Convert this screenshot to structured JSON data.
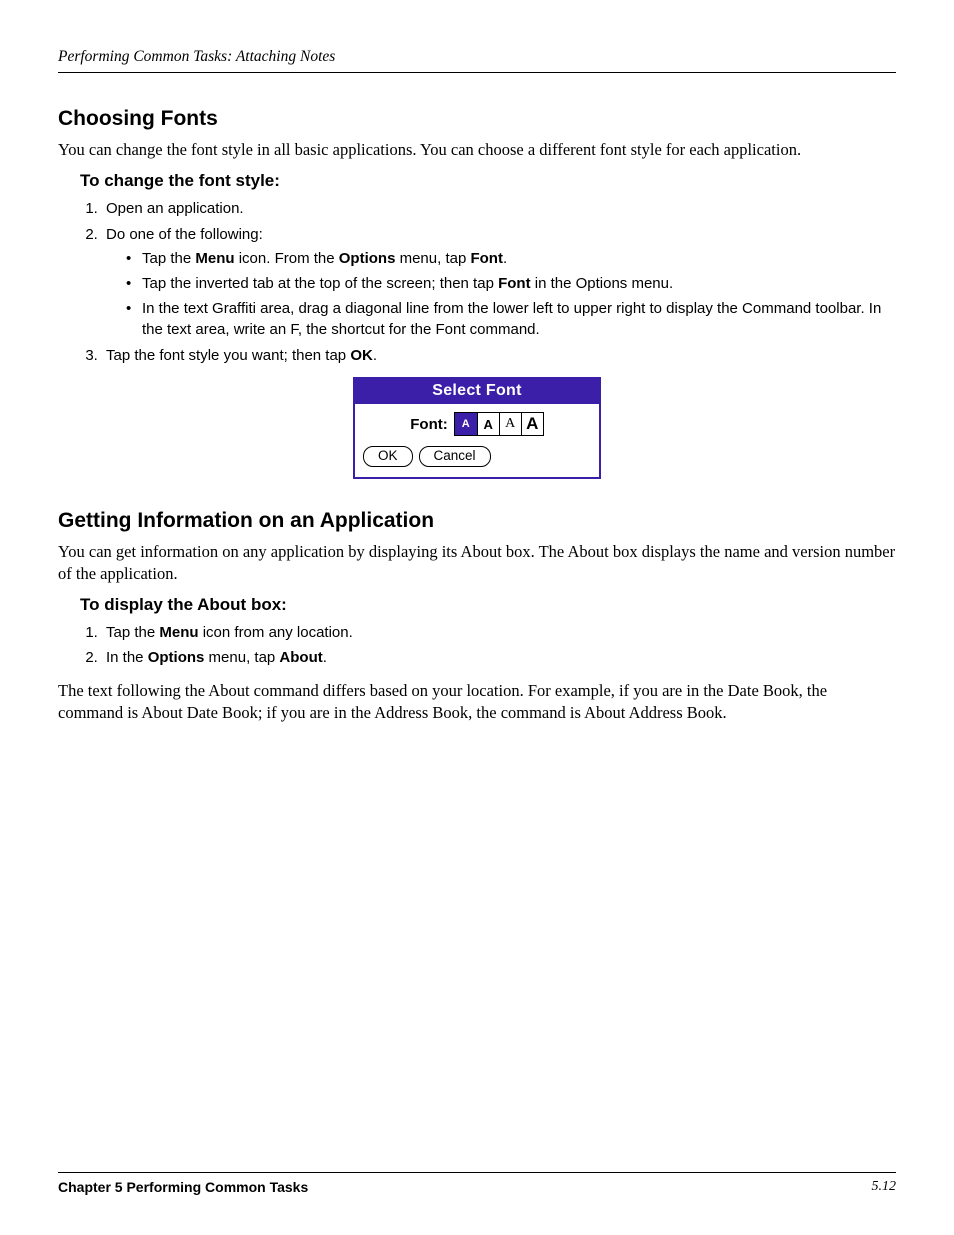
{
  "header": {
    "running": "Performing Common Tasks: Attaching Notes"
  },
  "sections": {
    "fonts": {
      "heading": "Choosing Fonts",
      "intro": "You can change the font style in all basic applications. You can choose a different font style for each application.",
      "procHeading": "To change the font style:",
      "step1": "Open an application.",
      "step2": "Do one of the following:",
      "bullet1": {
        "pre": "Tap the ",
        "b1": "Menu",
        "mid1": " icon. From the ",
        "b2": "Options",
        "mid2": " menu, tap ",
        "b3": "Font",
        "post": "."
      },
      "bullet2": {
        "pre": "Tap the inverted tab at the top of the screen; then tap ",
        "b1": "Font",
        "post": " in the Options menu."
      },
      "bullet3": "In the text Graffiti area, drag a diagonal line from the lower left to upper right to display the Command toolbar. In the text area, write an F, the shortcut for the Font command.",
      "step3": {
        "pre": "Tap the font style you want; then tap ",
        "b1": "OK",
        "post": "."
      }
    },
    "about": {
      "heading": "Getting Information on an Application",
      "intro": "You can get information on any application by displaying its About box. The About box displays the name and version number of the application.",
      "procHeading": "To display the About box:",
      "step1": {
        "pre": "Tap the ",
        "b1": "Menu",
        "post": " icon from any location."
      },
      "step2": {
        "pre": "In the ",
        "b1": "Options",
        "mid": " menu, tap ",
        "b2": "About",
        "post": "."
      },
      "outro": "The text following the About command differs based on your location. For example, if you are in the Date Book, the command is About Date Book; if you are in the Address Book, the command is About Address Book."
    }
  },
  "dialog": {
    "title": "Select Font",
    "label": "Font:",
    "glyph": "A",
    "ok": "OK",
    "cancel": "Cancel"
  },
  "footer": {
    "chapter": "Chapter 5 Performing Common Tasks",
    "page": "5.12"
  }
}
